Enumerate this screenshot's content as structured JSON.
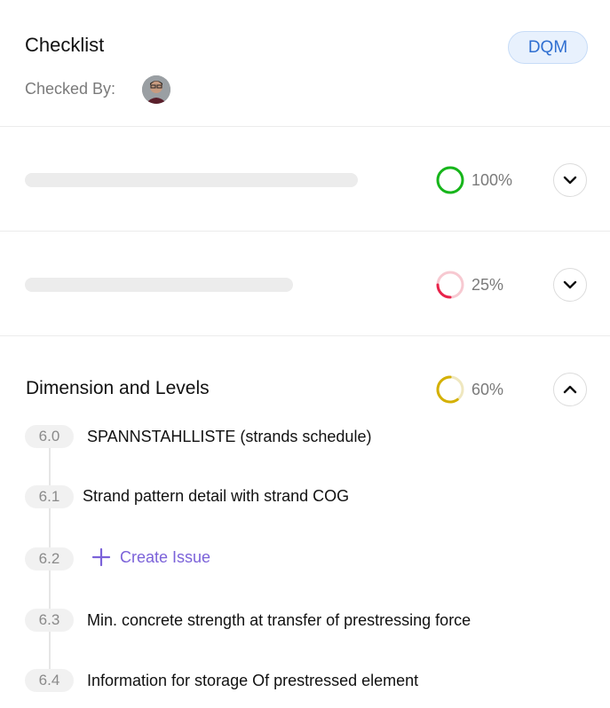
{
  "header": {
    "title": "Checklist",
    "badge": "DQM",
    "checked_by_label": "Checked By:",
    "avatar_icon": "user-avatar"
  },
  "sections": [
    {
      "percent_label": "100%",
      "progress": 1.0,
      "color": "#17b51b",
      "expanded": false
    },
    {
      "percent_label": "25%",
      "progress": 0.25,
      "color": "#e8234a",
      "expanded": false
    },
    {
      "title": "Dimension and Levels",
      "percent_label": "60%",
      "progress": 0.6,
      "color": "#d4b000",
      "expanded": true,
      "items": [
        {
          "number": "6.0",
          "label": "SPANNSTAHLLISTE (strands schedule)"
        },
        {
          "number": "6.1",
          "label": "Strand pattern detail with strand COG"
        },
        {
          "number": "6.2",
          "label": "Create Issue",
          "action": true
        },
        {
          "number": "6.3",
          "label": "Min. concrete strength at transfer of prestressing force"
        },
        {
          "number": "6.4",
          "label": "Information for storage Of prestressed element"
        }
      ]
    }
  ],
  "colors": {
    "badge_text": "#2f6fd1",
    "accent_purple": "#7b62d9",
    "track_green": "#c9f0c9",
    "track_red": "#f7c9d1",
    "track_yellow": "#efe7bf"
  }
}
